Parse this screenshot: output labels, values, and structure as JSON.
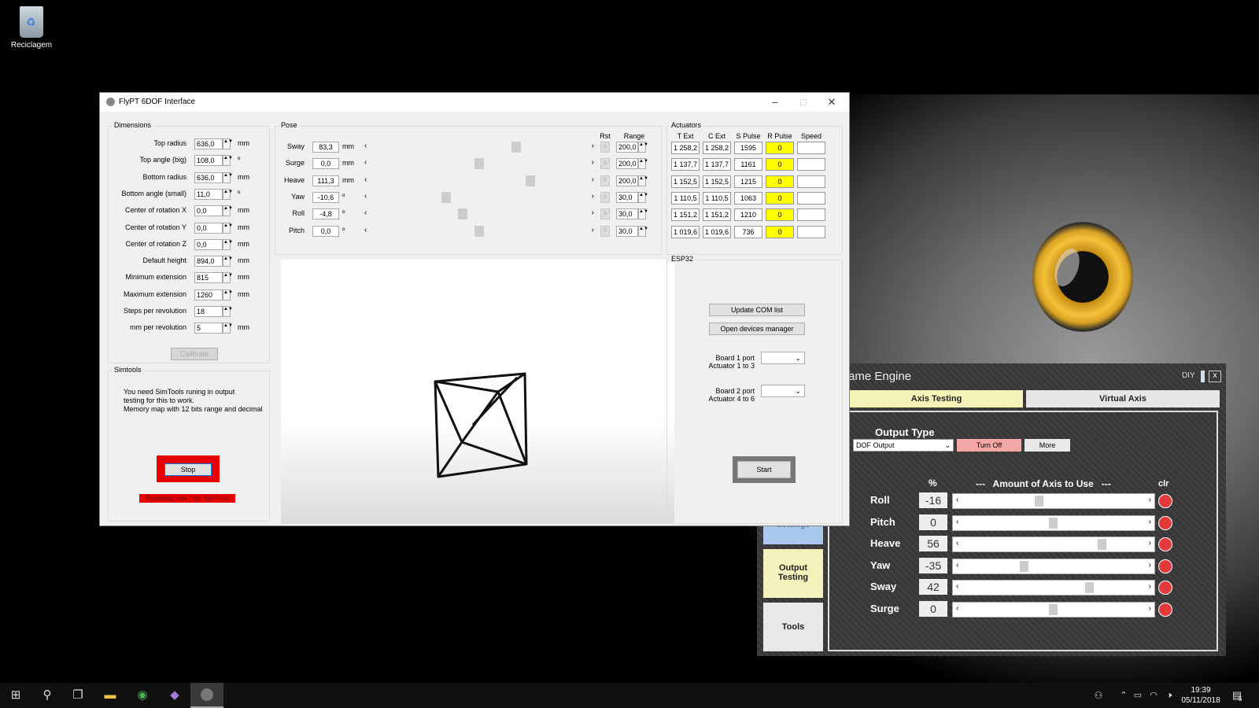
{
  "desktop": {
    "recycle_bin_label": "Reciclagem"
  },
  "window": {
    "title": "FlyPT 6DOF Interface"
  },
  "dimensions": {
    "group_label": "Dimensions",
    "rows": [
      {
        "label": "Top radius",
        "value": "636,0",
        "unit": "mm"
      },
      {
        "label": "Top angle (big)",
        "value": "108,0",
        "unit": "º"
      },
      {
        "label": "Bottom radius",
        "value": "636,0",
        "unit": "mm"
      },
      {
        "label": "Bottom angle (small)",
        "value": "11,0",
        "unit": "º"
      },
      {
        "label": "Center of rotation X",
        "value": "0,0",
        "unit": "mm"
      },
      {
        "label": "Center of rotation Y",
        "value": "0,0",
        "unit": "mm"
      },
      {
        "label": "Center of rotation Z",
        "value": "0,0",
        "unit": "mm"
      },
      {
        "label": "Default height",
        "value": "894,0",
        "unit": "mm"
      },
      {
        "label": "Minimum extension",
        "value": "815",
        "unit": "mm"
      },
      {
        "label": "Maximum extension",
        "value": "1260",
        "unit": "mm"
      },
      {
        "label": "Steps per revolution",
        "value": "18",
        "unit": ""
      },
      {
        "label": "mm per revolution",
        "value": "5",
        "unit": "mm"
      }
    ],
    "calibrate_label": "Calibrate"
  },
  "simtools": {
    "group_label": "Simtools",
    "info_line1": "You need SimTools runing in output",
    "info_line2": "testing for this to work.",
    "info_line3": "Memory map with 12 bits range and decimal",
    "stop_label": "Stop",
    "status": "Receiving data from SimTools"
  },
  "pose": {
    "group_label": "Pose",
    "rst_header": "Rst",
    "range_header": "Range",
    "rows": [
      {
        "label": "Sway",
        "value": "83,3",
        "unit": "mm",
        "slider_fraction": 0.68,
        "rst": "0",
        "range": "200,0"
      },
      {
        "label": "Surge",
        "value": "0,0",
        "unit": "mm",
        "slider_fraction": 0.5,
        "rst": "0",
        "range": "200,0"
      },
      {
        "label": "Heave",
        "value": "111,3",
        "unit": "mm",
        "slider_fraction": 0.75,
        "rst": "0",
        "range": "200,0"
      },
      {
        "label": "Yaw",
        "value": "-10,6",
        "unit": "º",
        "slider_fraction": 0.34,
        "rst": "0",
        "range": "30,0"
      },
      {
        "label": "Roll",
        "value": "-4,8",
        "unit": "º",
        "slider_fraction": 0.42,
        "rst": "0",
        "range": "30,0"
      },
      {
        "label": "Pitch",
        "value": "0,0",
        "unit": "º",
        "slider_fraction": 0.5,
        "rst": "0",
        "range": "30,0"
      }
    ]
  },
  "actuators": {
    "group_label": "Actuators",
    "headers": [
      "T Ext",
      "C Ext",
      "S Pulse",
      "R Pulse",
      "Speed"
    ],
    "rows": [
      {
        "t_ext": "1 258,2",
        "c_ext": "1 258,2",
        "s_pulse": "1595",
        "r_pulse": "0",
        "speed": ""
      },
      {
        "t_ext": "1 137,7",
        "c_ext": "1 137,7",
        "s_pulse": "1161",
        "r_pulse": "0",
        "speed": ""
      },
      {
        "t_ext": "1 152,5",
        "c_ext": "1 152,5",
        "s_pulse": "1215",
        "r_pulse": "0",
        "speed": ""
      },
      {
        "t_ext": "1 110,5",
        "c_ext": "1 110,5",
        "s_pulse": "1063",
        "r_pulse": "0",
        "speed": ""
      },
      {
        "t_ext": "1 151,2",
        "c_ext": "1 151,2",
        "s_pulse": "1210",
        "r_pulse": "0",
        "speed": ""
      },
      {
        "t_ext": "1 019,6",
        "c_ext": "1 019,6",
        "s_pulse": "736",
        "r_pulse": "0",
        "speed": ""
      }
    ],
    "highlight_color": "#ffff00"
  },
  "esp32": {
    "group_label": "ESP32",
    "update_com_label": "Update COM list",
    "open_devices_label": "Open devices manager",
    "board1_label_line1": "Board 1 port",
    "board1_label_line2": "Actuator 1 to 3",
    "board2_label_line1": "Board 2 port",
    "board2_label_line2": "Actuator  4 to 6",
    "start_label": "Start"
  },
  "sim_engine": {
    "title": "ame Engine",
    "diy_label": "DIY",
    "close_label": "x",
    "tab_axis_testing": "Axis Testing",
    "tab_virtual_axis": "Virtual Axis",
    "output_type_label": "Output Type",
    "output_type_value": "DOF Output",
    "turn_off_label": "Turn Off",
    "more_label": "More",
    "percent_header": "%",
    "amount_header": "---   Amount of Axis to Use   ---",
    "clr_header": "clr",
    "sidebar_settings": "Settings",
    "sidebar_output_testing_line1": "Output",
    "sidebar_output_testing_line2": "Testing",
    "sidebar_tools": "Tools",
    "axes": [
      {
        "name": "Roll",
        "value": "-16",
        "fraction": 0.42
      },
      {
        "name": "Pitch",
        "value": "0",
        "fraction": 0.5
      },
      {
        "name": "Heave",
        "value": "56",
        "fraction": 0.78
      },
      {
        "name": "Yaw",
        "value": "-35",
        "fraction": 0.33
      },
      {
        "name": "Sway",
        "value": "42",
        "fraction": 0.71
      },
      {
        "name": "Surge",
        "value": "0",
        "fraction": 0.5
      }
    ]
  },
  "taskbar": {
    "time": "19:39",
    "date": "05/11/2018",
    "notification_count": "5"
  }
}
